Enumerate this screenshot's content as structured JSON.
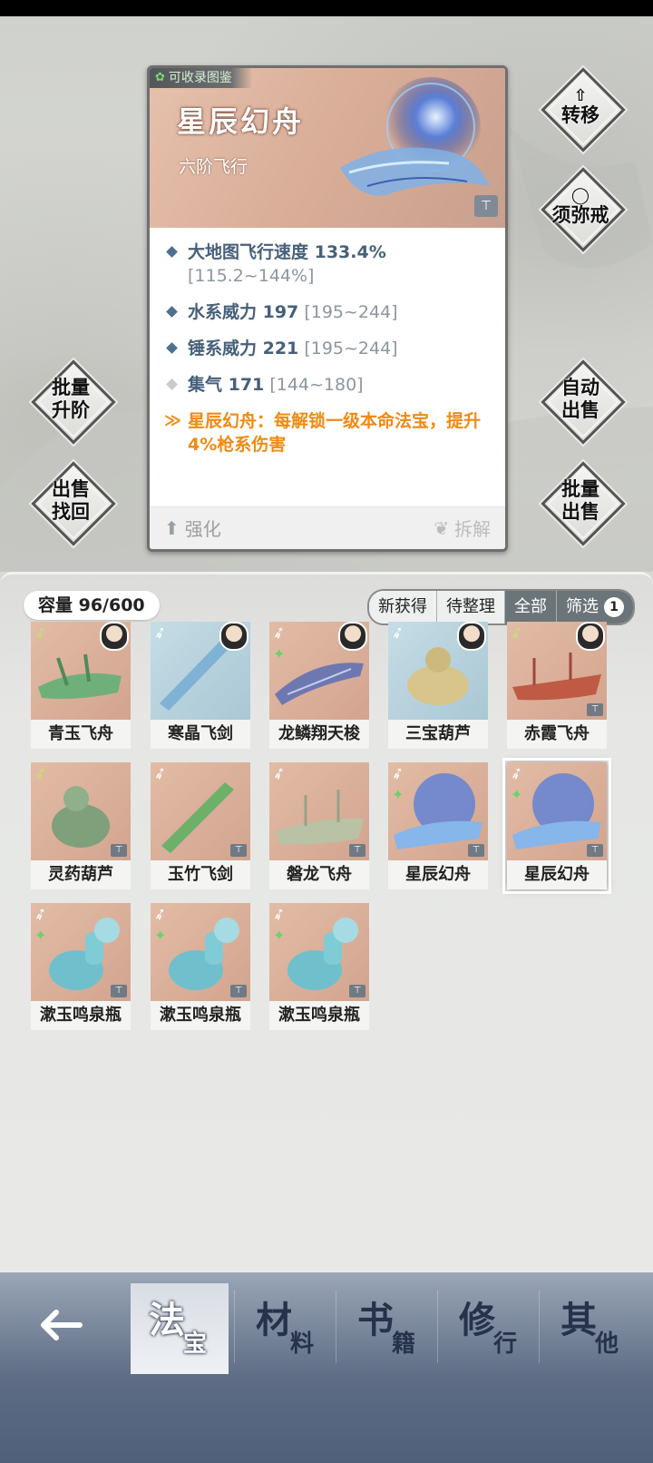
{
  "detail": {
    "badge": "可收录图鉴",
    "name": "星辰幻舟",
    "subtitle": "六阶飞行",
    "stats": [
      {
        "label": "大地图飞行速度 133.4%",
        "range": " [115.2~144%]"
      },
      {
        "label": "水系威力 197",
        "range": " [195~244]"
      },
      {
        "label": "锤系威力 221",
        "range": " [195~244]"
      },
      {
        "label": "集气 171",
        "range": " [144~180]"
      }
    ],
    "special": "星辰幻舟：每解锁一级本命法宝，提升4%枪系伤害",
    "enhance_label": "强化",
    "dismantle_label": "拆解"
  },
  "side_buttons": {
    "transfer": [
      "转移"
    ],
    "xumi": [
      "须弥戒"
    ],
    "batch_upgrade": [
      "批量",
      "升阶"
    ],
    "auto_sell": [
      "自动",
      "出售"
    ],
    "sell_recover": [
      "出售",
      "找回"
    ],
    "batch_sell": [
      "批量",
      "出售"
    ]
  },
  "inventory": {
    "capacity": "容量 96/600",
    "filters": [
      "新获得",
      "待整理",
      "全部",
      "筛选"
    ],
    "filter_count": "1",
    "items": [
      {
        "name": "青玉飞舟"
      },
      {
        "name": "寒晶飞剑"
      },
      {
        "name": "龙鳞翔天梭"
      },
      {
        "name": "三宝葫芦"
      },
      {
        "name": "赤霞飞舟"
      },
      {
        "name": "灵药葫芦"
      },
      {
        "name": "玉竹飞剑"
      },
      {
        "name": "磐龙飞舟"
      },
      {
        "name": "星辰幻舟"
      },
      {
        "name": "星辰幻舟"
      },
      {
        "name": "漱玉鸣泉瓶"
      },
      {
        "name": "漱玉鸣泉瓶"
      },
      {
        "name": "漱玉鸣泉瓶"
      }
    ]
  },
  "nav": {
    "tabs": [
      {
        "big": "法",
        "small": "宝"
      },
      {
        "big": "材",
        "small": "料"
      },
      {
        "big": "书",
        "small": "籍"
      },
      {
        "big": "修",
        "small": "行"
      },
      {
        "big": "其",
        "small": "他"
      }
    ]
  },
  "colors": {
    "stat_text": "#46607a",
    "special_text": "#f08a12",
    "nav_bg": "#5e6d85"
  }
}
